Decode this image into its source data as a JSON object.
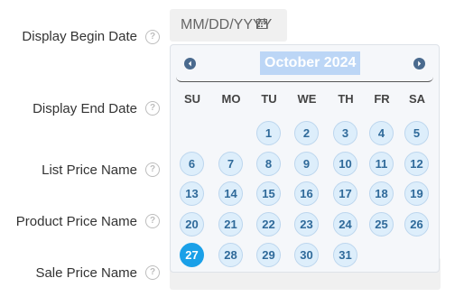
{
  "form": {
    "labels": {
      "display_begin_date": "Display Begin Date",
      "display_end_date": "Display End Date",
      "list_price_name": "List Price Name",
      "product_price_name": "Product Price Name",
      "sale_price_name": "Sale Price Name"
    },
    "help_glyph": "?",
    "begin_date": {
      "value": "",
      "placeholder": "MM/DD/YYYY"
    }
  },
  "datepicker": {
    "title": "October 2024",
    "prev_icon": "chevron-left-icon",
    "next_icon": "chevron-right-icon",
    "weekdays": [
      "SU",
      "MO",
      "TU",
      "WE",
      "TH",
      "FR",
      "SA"
    ],
    "weeks": [
      [
        "",
        "",
        "1",
        "2",
        "3",
        "4",
        "5"
      ],
      [
        "6",
        "7",
        "8",
        "9",
        "10",
        "11",
        "12"
      ],
      [
        "13",
        "14",
        "15",
        "16",
        "17",
        "18",
        "19"
      ],
      [
        "20",
        "21",
        "22",
        "23",
        "24",
        "25",
        "26"
      ],
      [
        "27",
        "28",
        "29",
        "30",
        "31",
        "",
        ""
      ]
    ],
    "selected_day": "27",
    "colors": {
      "selected": "#1aa0e8",
      "day_bg": "#ddeefb",
      "day_text": "#2f6a9a",
      "title_highlight": "#bcd6f6",
      "nav": "#4a6a8e"
    }
  }
}
